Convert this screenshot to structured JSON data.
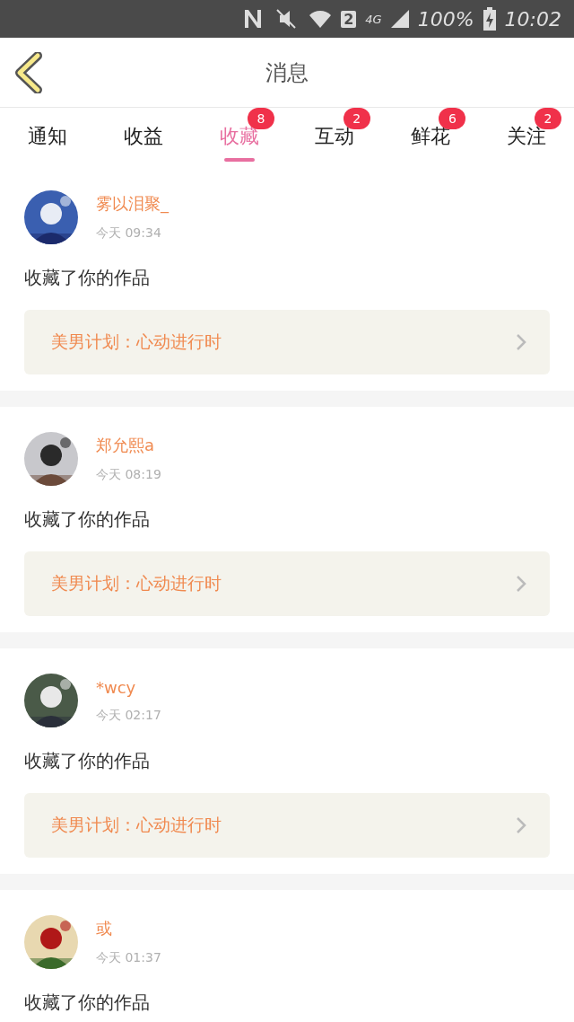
{
  "status_bar": {
    "sim": "2",
    "network": "4G",
    "battery": "100%",
    "time": "10:02"
  },
  "header": {
    "title": "消息"
  },
  "tabs": [
    {
      "label": "通知",
      "selected": false
    },
    {
      "label": "收益",
      "selected": false
    },
    {
      "label": "收藏",
      "selected": true,
      "badge": "8"
    },
    {
      "label": "互动",
      "selected": false,
      "badge": "2"
    },
    {
      "label": "鲜花",
      "selected": false,
      "badge": "6"
    },
    {
      "label": "关注",
      "selected": false,
      "badge": "2"
    }
  ],
  "messages": [
    {
      "name": "雾以泪聚_",
      "time": "今天 09:34",
      "text": "收藏了你的作品",
      "work": "美男计划：心动进行时"
    },
    {
      "name": "郑允熙a",
      "time": "今天 08:19",
      "text": "收藏了你的作品",
      "work": "美男计划：心动进行时"
    },
    {
      "name": "*wcy",
      "time": "今天 02:17",
      "text": "收藏了你的作品",
      "work": "美男计划：心动进行时"
    },
    {
      "name": "或",
      "time": "今天 01:37",
      "text": "收藏了你的作品"
    }
  ]
}
